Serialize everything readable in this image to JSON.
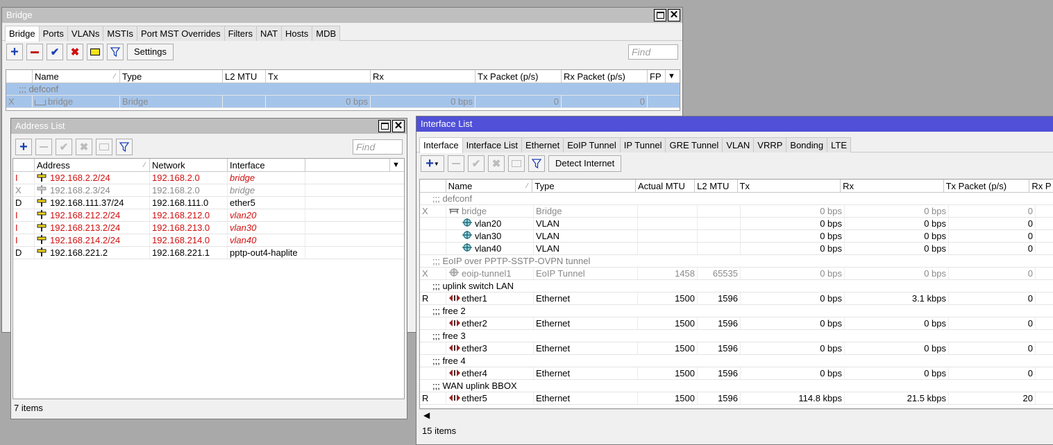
{
  "bridge_window": {
    "title": "Bridge",
    "tabs": [
      "Bridge",
      "Ports",
      "VLANs",
      "MSTIs",
      "Port MST Overrides",
      "Filters",
      "NAT",
      "Hosts",
      "MDB"
    ],
    "settings_label": "Settings",
    "find_placeholder": "Find",
    "columns": [
      "Name",
      "Type",
      "L2 MTU",
      "Tx",
      "Rx",
      "Tx Packet (p/s)",
      "Rx Packet (p/s)",
      "FP"
    ],
    "comment": ";;; defconf",
    "row": {
      "flag": "X",
      "name": "bridge",
      "type": "Bridge",
      "l2mtu": "",
      "tx": "0 bps",
      "rx": "0 bps",
      "txp": "0",
      "rxp": "0"
    }
  },
  "address_window": {
    "title": "Address List",
    "find_placeholder": "Find",
    "columns": [
      "Address",
      "Network",
      "Interface"
    ],
    "rows": [
      {
        "flag": "I",
        "address": "192.168.2.2/24",
        "network": "192.168.2.0",
        "iface": "bridge",
        "style": "red"
      },
      {
        "flag": "X",
        "address": "192.168.2.3/24",
        "network": "192.168.2.0",
        "iface": "bridge",
        "style": "gray"
      },
      {
        "flag": "D",
        "address": "192.168.111.37/24",
        "network": "192.168.111.0",
        "iface": "ether5",
        "style": "normal"
      },
      {
        "flag": "I",
        "address": "192.168.212.2/24",
        "network": "192.168.212.0",
        "iface": "vlan20",
        "style": "red"
      },
      {
        "flag": "I",
        "address": "192.168.213.2/24",
        "network": "192.168.213.0",
        "iface": "vlan30",
        "style": "red"
      },
      {
        "flag": "I",
        "address": "192.168.214.2/24",
        "network": "192.168.214.0",
        "iface": "vlan40",
        "style": "red"
      },
      {
        "flag": "D",
        "address": "192.168.221.2",
        "network": "192.168.221.1",
        "iface": "pptp-out4-haplite",
        "style": "normal"
      }
    ],
    "status": "7 items"
  },
  "interface_window": {
    "title": "Interface List",
    "tabs": [
      "Interface",
      "Interface List",
      "Ethernet",
      "EoIP Tunnel",
      "IP Tunnel",
      "GRE Tunnel",
      "VLAN",
      "VRRP",
      "Bonding",
      "LTE"
    ],
    "detect_label": "Detect Internet",
    "columns": [
      "Name",
      "Type",
      "Actual MTU",
      "L2 MTU",
      "Tx",
      "Rx",
      "Tx Packet (p/s)",
      "Rx P"
    ],
    "rows": [
      {
        "kind": "comment",
        "text": ";;; defconf",
        "dark": false
      },
      {
        "kind": "row",
        "flag": "X",
        "name": "bridge",
        "type": "Bridge",
        "amtu": "",
        "l2mtu": "",
        "tx": "0 bps",
        "rx": "0 bps",
        "txp": "0",
        "style": "gray",
        "icon": "bridge",
        "indent": 0
      },
      {
        "kind": "row",
        "flag": "",
        "name": "vlan20",
        "type": "VLAN",
        "amtu": "",
        "l2mtu": "",
        "tx": "0 bps",
        "rx": "0 bps",
        "txp": "0",
        "style": "normal",
        "icon": "vlan",
        "indent": 1
      },
      {
        "kind": "row",
        "flag": "",
        "name": "vlan30",
        "type": "VLAN",
        "amtu": "",
        "l2mtu": "",
        "tx": "0 bps",
        "rx": "0 bps",
        "txp": "0",
        "style": "normal",
        "icon": "vlan",
        "indent": 1
      },
      {
        "kind": "row",
        "flag": "",
        "name": "vlan40",
        "type": "VLAN",
        "amtu": "",
        "l2mtu": "",
        "tx": "0 bps",
        "rx": "0 bps",
        "txp": "0",
        "style": "normal",
        "icon": "vlan",
        "indent": 1
      },
      {
        "kind": "comment",
        "text": ";;; EoIP over PPTP-SSTP-OVPN tunnel",
        "dark": false
      },
      {
        "kind": "row",
        "flag": "X",
        "name": "eoip-tunnel1",
        "type": "EoIP Tunnel",
        "amtu": "1458",
        "l2mtu": "65535",
        "tx": "0 bps",
        "rx": "0 bps",
        "txp": "0",
        "style": "gray",
        "icon": "eoip",
        "indent": 0
      },
      {
        "kind": "comment",
        "text": ";;; uplink switch LAN",
        "dark": true
      },
      {
        "kind": "row",
        "flag": "R",
        "name": "ether1",
        "type": "Ethernet",
        "amtu": "1500",
        "l2mtu": "1596",
        "tx": "0 bps",
        "rx": "3.1 kbps",
        "txp": "0",
        "style": "normal",
        "icon": "eth",
        "indent": 0
      },
      {
        "kind": "comment",
        "text": ";;; free 2",
        "dark": true
      },
      {
        "kind": "row",
        "flag": "",
        "name": "ether2",
        "type": "Ethernet",
        "amtu": "1500",
        "l2mtu": "1596",
        "tx": "0 bps",
        "rx": "0 bps",
        "txp": "0",
        "style": "normal",
        "icon": "eth",
        "indent": 0
      },
      {
        "kind": "comment",
        "text": ";;; free 3",
        "dark": true
      },
      {
        "kind": "row",
        "flag": "",
        "name": "ether3",
        "type": "Ethernet",
        "amtu": "1500",
        "l2mtu": "1596",
        "tx": "0 bps",
        "rx": "0 bps",
        "txp": "0",
        "style": "normal",
        "icon": "eth",
        "indent": 0
      },
      {
        "kind": "comment",
        "text": ";;; free 4",
        "dark": true
      },
      {
        "kind": "row",
        "flag": "",
        "name": "ether4",
        "type": "Ethernet",
        "amtu": "1500",
        "l2mtu": "1596",
        "tx": "0 bps",
        "rx": "0 bps",
        "txp": "0",
        "style": "normal",
        "icon": "eth",
        "indent": 0
      },
      {
        "kind": "comment",
        "text": ";;; WAN uplink BBOX",
        "dark": true
      },
      {
        "kind": "row",
        "flag": "R",
        "name": "ether5",
        "type": "Ethernet",
        "amtu": "1500",
        "l2mtu": "1596",
        "tx": "114.8 kbps",
        "rx": "21.5 kbps",
        "txp": "20",
        "style": "normal",
        "icon": "eth",
        "indent": 0
      }
    ],
    "status": "15 items"
  },
  "colors": {
    "active_title": "#5050d8",
    "inactive_title": "#bfbfbf",
    "selected_row": "#a5c4ea",
    "invalid": "#d01010",
    "disabled": "#8a8a8a"
  }
}
